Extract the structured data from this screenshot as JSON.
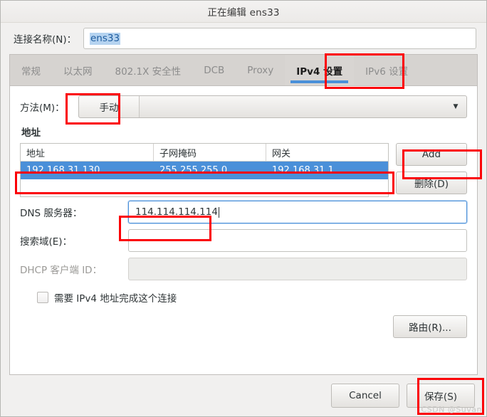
{
  "window": {
    "title": "正在编辑 ens33"
  },
  "connection": {
    "label": "连接名称(N)：",
    "value": "ens33",
    "placeholder": ""
  },
  "tabs": [
    {
      "label": "常规",
      "active": false
    },
    {
      "label": "以太网",
      "active": false
    },
    {
      "label": "802.1X 安全性",
      "active": false
    },
    {
      "label": "DCB",
      "active": false
    },
    {
      "label": "Proxy",
      "active": false
    },
    {
      "label": "IPv4 设置",
      "active": true
    },
    {
      "label": "IPv6 设置",
      "active": false
    }
  ],
  "method": {
    "label": "方法(M)：",
    "value": "手动",
    "arrow": "▼"
  },
  "addresses": {
    "section_title": "地址",
    "columns": [
      "地址",
      "子网掩码",
      "网关"
    ],
    "rows": [
      {
        "address": "192.168.31.130",
        "netmask": "255.255.255.0",
        "gateway": "192.168.31.1"
      }
    ],
    "add_button": "Add",
    "delete_button": "删除(D)"
  },
  "fields": {
    "dns_label": "DNS 服务器：",
    "dns_value": "114.114.114.114",
    "search_label": "搜索域(E)：",
    "search_value": "",
    "dhcp_label": "DHCP 客户端 ID：",
    "dhcp_value": ""
  },
  "require_ipv4": {
    "label": "需要 IPv4 地址完成这个连接",
    "checked": false
  },
  "routes_button": "路由(R)...",
  "actions": {
    "cancel": "Cancel",
    "save": "保存(S)"
  },
  "watermark": "CSDN @Suvan",
  "colors": {
    "accent": "#4a90d9",
    "selection_row": "#4a90d9",
    "highlight_box": "#fb0007",
    "window_bg": "#f1f0ef",
    "tabstrip_bg": "#d6d3d0"
  }
}
